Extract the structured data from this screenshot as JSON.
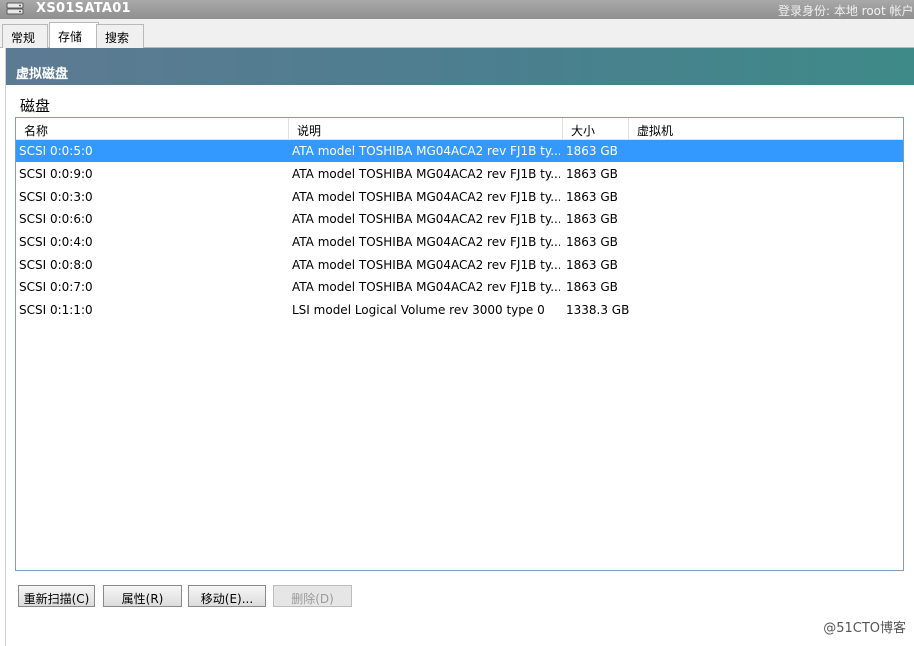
{
  "window": {
    "server_name": "XS01SATA01",
    "login_info": "登录身份: 本地 root 帐户",
    "server_icon": "server-icon"
  },
  "tabs": [
    {
      "label": "常规"
    },
    {
      "label": "存储"
    },
    {
      "label": "搜索"
    }
  ],
  "section": {
    "title": "虚拟磁盘",
    "disk_label": "磁盘"
  },
  "table": {
    "columns": [
      "名称",
      "说明",
      "大小",
      "虚拟机"
    ],
    "rows": [
      {
        "name": "SCSI 0:0:5:0",
        "desc": "ATA model TOSHIBA MG04ACA2 rev FJ1B ty...",
        "size": "1863 GB",
        "vm": ""
      },
      {
        "name": "SCSI 0:0:9:0",
        "desc": "ATA model TOSHIBA MG04ACA2 rev FJ1B ty...",
        "size": "1863 GB",
        "vm": ""
      },
      {
        "name": "SCSI 0:0:3:0",
        "desc": "ATA model TOSHIBA MG04ACA2 rev FJ1B ty...",
        "size": "1863 GB",
        "vm": ""
      },
      {
        "name": "SCSI 0:0:6:0",
        "desc": "ATA model TOSHIBA MG04ACA2 rev FJ1B ty...",
        "size": "1863 GB",
        "vm": ""
      },
      {
        "name": "SCSI 0:0:4:0",
        "desc": "ATA model TOSHIBA MG04ACA2 rev FJ1B ty...",
        "size": "1863 GB",
        "vm": ""
      },
      {
        "name": "SCSI 0:0:8:0",
        "desc": "ATA model TOSHIBA MG04ACA2 rev FJ1B ty...",
        "size": "1863 GB",
        "vm": ""
      },
      {
        "name": "SCSI 0:0:7:0",
        "desc": "ATA model TOSHIBA MG04ACA2 rev FJ1B ty...",
        "size": "1863 GB",
        "vm": ""
      },
      {
        "name": "SCSI 0:1:1:0",
        "desc": "LSI model Logical Volume rev 3000 type 0",
        "size": "1338.3 GB",
        "vm": ""
      }
    ]
  },
  "buttons": {
    "rescan": "重新扫描(C)",
    "properties": "属性(R)",
    "move": "移动(E)...",
    "delete": "删除(D)"
  },
  "watermark": "@51CTO博客",
  "colors": {
    "selection": "#3399ff",
    "header_gradient_start": "#5d7a93",
    "header_gradient_end": "#3e8a88"
  }
}
